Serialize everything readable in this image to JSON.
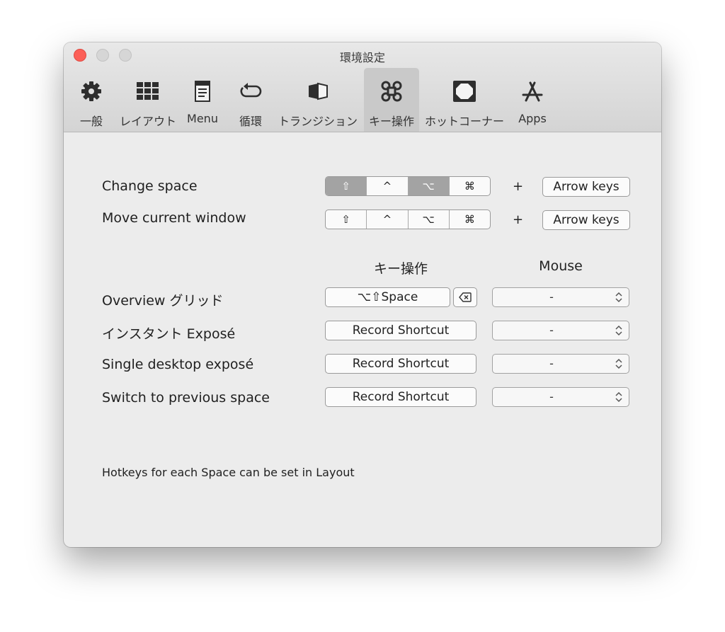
{
  "window": {
    "title": "環境設定"
  },
  "toolbar": {
    "tabs": [
      {
        "label": "一般",
        "icon": "gear-icon"
      },
      {
        "label": "レイアウト",
        "icon": "grid-icon"
      },
      {
        "label": "Menu",
        "icon": "menu-icon"
      },
      {
        "label": "循環",
        "icon": "cycle-icon"
      },
      {
        "label": "トランジション",
        "icon": "transition-icon"
      },
      {
        "label": "キー操作",
        "icon": "command-key-icon",
        "active": true
      },
      {
        "label": "ホットコーナー",
        "icon": "hot-corner-icon"
      },
      {
        "label": "Apps",
        "icon": "app-store-icon"
      }
    ]
  },
  "modifiers": {
    "shift": "⇧",
    "control": "^",
    "option": "⌥",
    "command": "⌘"
  },
  "rows": {
    "change_space": {
      "label": "Change space",
      "plus": "+",
      "arrow_keys": "Arrow keys"
    },
    "move_window": {
      "label": "Move current window",
      "plus": "+",
      "arrow_keys": "Arrow keys"
    }
  },
  "columns": {
    "keys": "キー操作",
    "mouse": "Mouse"
  },
  "shortcuts": [
    {
      "label": "Overview グリッド",
      "shortcut": "⌥⇧Space",
      "mouse": "-"
    },
    {
      "label": "インスタント Exposé",
      "shortcut": "Record Shortcut",
      "mouse": "-"
    },
    {
      "label": "Single desktop exposé",
      "shortcut": "Record Shortcut",
      "mouse": "-"
    },
    {
      "label": "Switch to previous space",
      "shortcut": "Record Shortcut",
      "mouse": "-"
    }
  ],
  "footnote": "Hotkeys for each Space can be set in Layout",
  "colors": {
    "close": "#fc5f57",
    "segment_active": "#a3a3a3",
    "tab_active": "#c9c9c9"
  }
}
